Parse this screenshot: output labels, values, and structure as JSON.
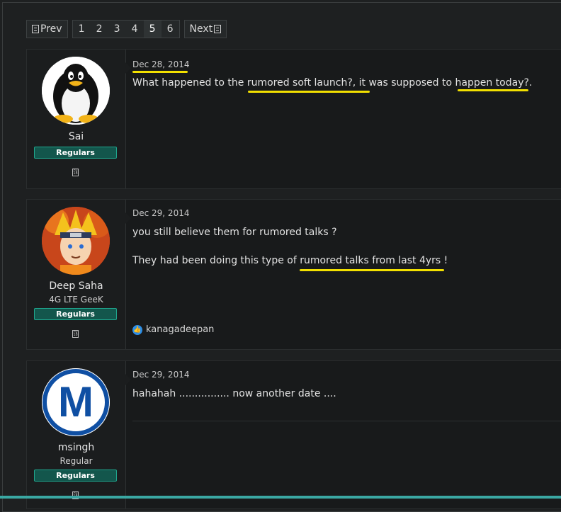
{
  "pagination": {
    "prev_label": "Prev",
    "next_label": "Next",
    "pages": [
      "1",
      "2",
      "3",
      "4",
      "5",
      "6"
    ],
    "current_page": "5"
  },
  "posts": [
    {
      "username": "Sai",
      "user_title": "",
      "badge": "Regulars",
      "date": "Dec 28, 2014",
      "text": "What happened to the rumored soft launch?, it was supposed to happen today?."
    },
    {
      "username": "Deep Saha",
      "user_title": "4G LTE GeeK",
      "badge": "Regulars",
      "date": "Dec 29, 2014",
      "text_line1": "you still believe them for rumored talks ?",
      "text_line2": "They had been doing this type of rumored talks from last 4yrs !",
      "reaction_user": "kanagadeepan"
    },
    {
      "username": "msingh",
      "user_title": "Regular",
      "badge": "Regulars",
      "avatar_letter": "M",
      "date": "Dec 29, 2014",
      "text": "hahahah ................ now another date ...."
    }
  ],
  "colors": {
    "accent": "#1fa68e",
    "highlight": "#f2e000",
    "bottom_bar": "#3aa8a3"
  },
  "icons": {
    "pager_prev": "prev-glyph-icon",
    "pager_next": "next-glyph-icon",
    "gender": "gender-icon",
    "like": "thumbs-up-icon"
  }
}
